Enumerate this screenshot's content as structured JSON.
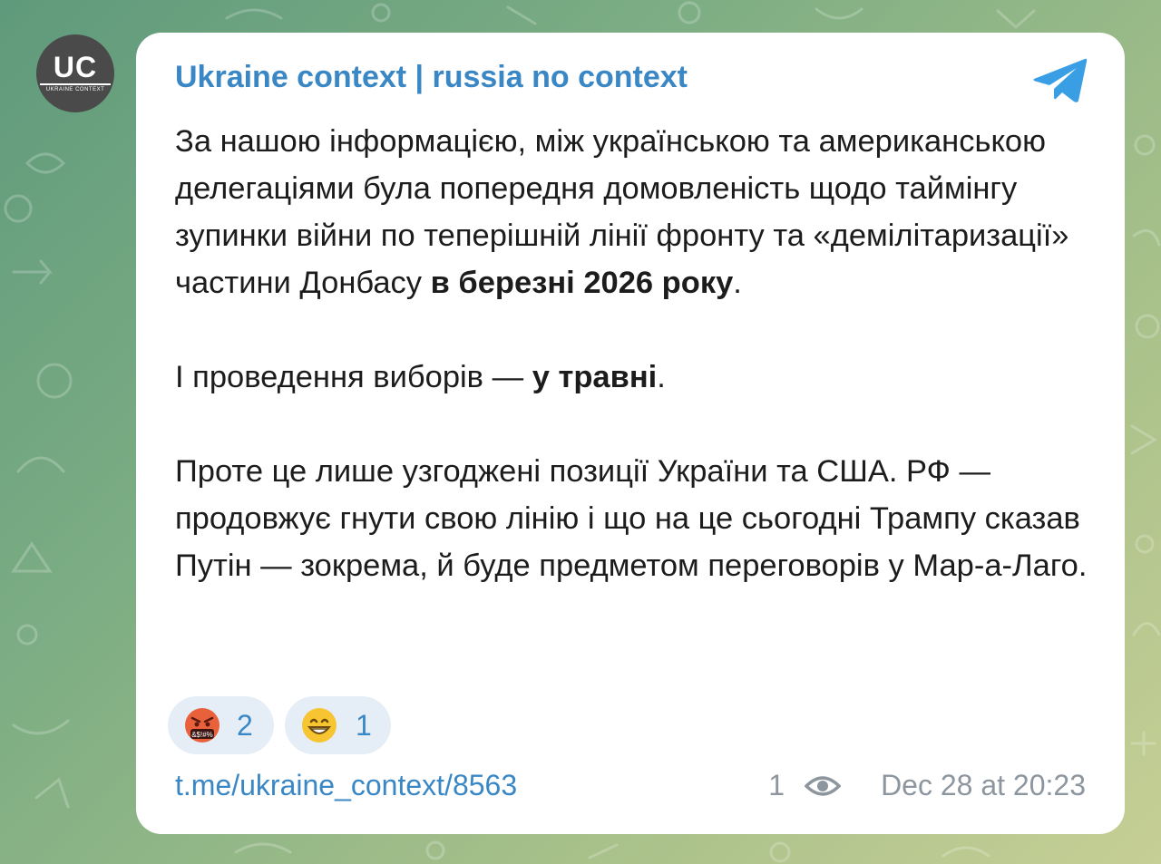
{
  "channel": {
    "name": "Ukraine context | russia no context",
    "avatar_text": "UC",
    "avatar_subtext": "UKRAINE CONTEXT"
  },
  "message": {
    "p1": {
      "text_a": "За нашою інформацією, між українською та американською делегаціями була попередня домовленість щодо таймінгу зупинки війни по теперішній лінії фронту та «демілітаризації» частини Донбасу ",
      "bold": "в березні 2026 року",
      "text_b": "."
    },
    "p2": {
      "text_a": "І проведення виборів — ",
      "bold": "у травні",
      "text_b": "."
    },
    "p3": {
      "text": "Проте це лише узгоджені позиції України та США. РФ — продовжує гнути свою лінію і що на це сьогодні Трампу сказав Путін — зокрема, й буде предметом переговорів у Мар-а-Лаго."
    }
  },
  "reactions": [
    {
      "emoji": "angry-swearing-face",
      "count": "2"
    },
    {
      "emoji": "grinning-face",
      "count": "1"
    }
  ],
  "footer": {
    "link": "t.me/ukraine_context/8563",
    "views": "1",
    "time": "Dec 28 at 20:23"
  },
  "colors": {
    "accent": "#3a87c6",
    "meta": "#8d969e",
    "reaction_bg": "#e5eef6",
    "card": "#ffffff"
  }
}
